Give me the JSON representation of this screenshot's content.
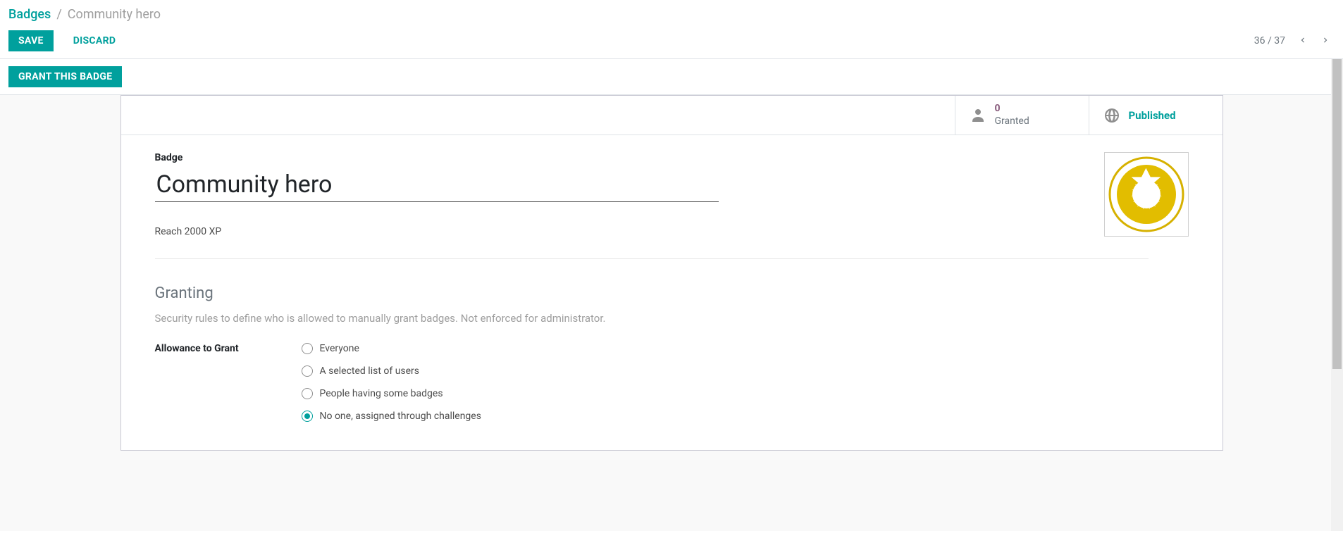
{
  "breadcrumb": {
    "root": "Badges",
    "sep": "/",
    "current": "Community hero"
  },
  "actions": {
    "save": "SAVE",
    "discard": "DISCARD",
    "grant_this_badge": "GRANT THIS BADGE"
  },
  "pager": {
    "text": "36 / 37"
  },
  "status": {
    "granted_count": "0",
    "granted_label": "Granted",
    "published_label": "Published"
  },
  "form": {
    "badge_field_label": "Badge",
    "title": "Community hero",
    "description": "Reach 2000 XP"
  },
  "granting": {
    "title": "Granting",
    "help": "Security rules to define who is allowed to manually grant badges. Not enforced for administrator.",
    "label": "Allowance to Grant",
    "options": [
      {
        "label": "Everyone"
      },
      {
        "label": "A selected list of users"
      },
      {
        "label": "People having some badges"
      },
      {
        "label": "No one, assigned through challenges"
      }
    ],
    "selected_index": 3
  }
}
